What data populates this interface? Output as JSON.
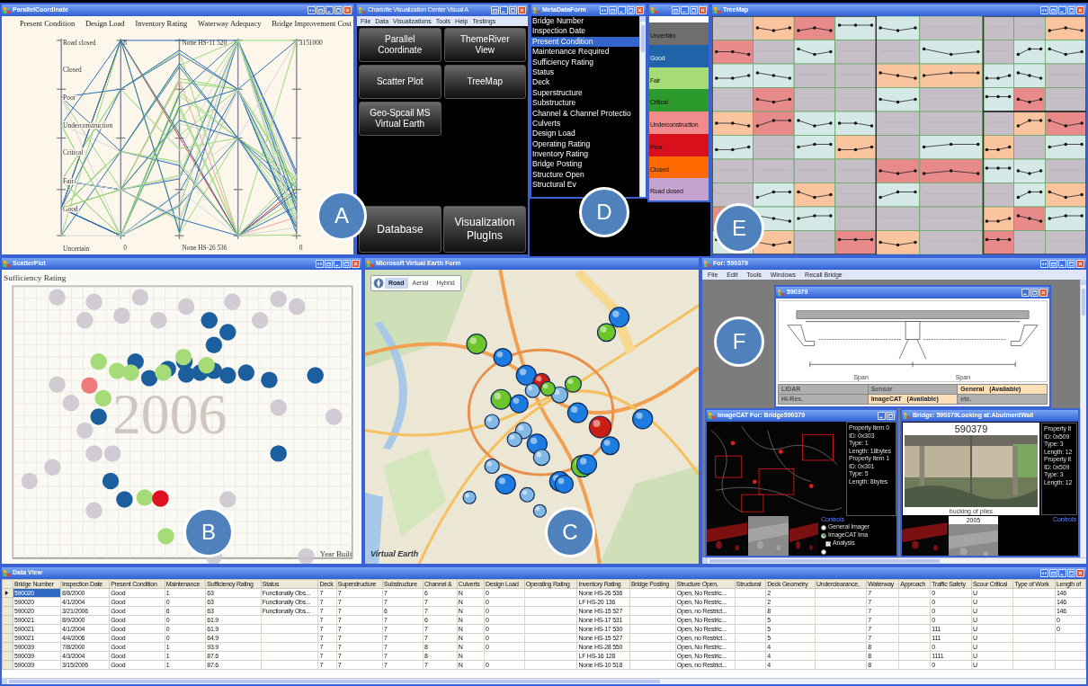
{
  "parallel_coordinate": {
    "title": "ParallelCoordinate",
    "axes": [
      {
        "title": "Present Condition"
      },
      {
        "title": "Design Load",
        "top_label": "8",
        "bottom_label": "0"
      },
      {
        "title": "Inventory Rating",
        "top_label": "None HS-11 520",
        "bottom_label": "None HS-26 536"
      },
      {
        "title": "Waterway Adequacy"
      },
      {
        "title": "Bridge Improvement Cost",
        "top_label": "3151000",
        "bottom_label": "0"
      }
    ],
    "category_labels": [
      "Road closed",
      "Closed",
      "Poor",
      "Underconstruction",
      "Critical",
      "Fair",
      "Good",
      "Uncertain"
    ]
  },
  "app": {
    "title": "Charlotte Visualization Center Visual A",
    "menu": [
      "File",
      "Data",
      "Visualizations",
      "Tools",
      "Help",
      "Testings"
    ],
    "buttons": [
      {
        "lines": [
          "Parallel",
          "Coordinate"
        ]
      },
      {
        "lines": [
          "ThemeRiver",
          "View"
        ]
      },
      {
        "lines": [
          "Scatter Plot"
        ]
      },
      {
        "lines": [
          "TreeMap"
        ]
      },
      {
        "lines": [
          "Geo-Spcail MS",
          "Virtual Earth"
        ]
      }
    ],
    "bottom_buttons": [
      {
        "lines": [
          "Database"
        ]
      },
      {
        "lines": [
          "Visualization",
          "PlugIns"
        ]
      }
    ]
  },
  "metadata_form": {
    "title": "MetaDataForm",
    "items": [
      {
        "label": "Bridge Number",
        "selected": false
      },
      {
        "label": "Inspection Date",
        "selected": false
      },
      {
        "label": "Present Condition",
        "selected": true
      },
      {
        "label": "Maintenance Required",
        "selected": false
      },
      {
        "label": "Sufficiency Rating",
        "selected": false
      },
      {
        "label": "Status",
        "selected": false
      },
      {
        "label": "Deck",
        "selected": false
      },
      {
        "label": "Superstructure",
        "selected": false
      },
      {
        "label": "Substructure",
        "selected": false
      },
      {
        "label": "Channel & Channel Protectio",
        "selected": false
      },
      {
        "label": "Culverts",
        "selected": false
      },
      {
        "label": "Design Load",
        "selected": false
      },
      {
        "label": "Operating Rating",
        "selected": false
      },
      {
        "label": "Inventory Rating",
        "selected": false
      },
      {
        "label": "Bridge Posting",
        "selected": false
      },
      {
        "label": "Structure Open",
        "selected": false
      },
      {
        "label": "Structural Ev",
        "selected": false
      }
    ]
  },
  "legend": {
    "items": [
      {
        "label": "Uncertain",
        "color": "#6e6e6e"
      },
      {
        "label": "Good",
        "color": "#1f64a8"
      },
      {
        "label": "Fair",
        "color": "#a6dc78"
      },
      {
        "label": "Critical",
        "color": "#2c9a2c"
      },
      {
        "label": "Underconstruction",
        "color": "#f28b8b"
      },
      {
        "label": "Poor",
        "color": "#d7101c"
      },
      {
        "label": "Closed",
        "color": "#ff6a00"
      },
      {
        "label": "Road closed",
        "color": "#c5a3d0"
      }
    ]
  },
  "treemap": {
    "title": "TreeMap"
  },
  "scatter_plot": {
    "title": "ScatterPlot",
    "y_label": "Sufficiency Rating",
    "x_label": "Year Built",
    "year": "2006"
  },
  "map": {
    "title": "Microsoft Virtual Earth Form",
    "view_tabs": [
      {
        "label": "Road",
        "selected": true
      },
      {
        "label": "Aerial",
        "selected": false
      },
      {
        "label": "Hybrid",
        "selected": false
      }
    ],
    "logo": "Virtual Earth"
  },
  "bridge_window": {
    "title": "For: 590379",
    "menu": [
      "File",
      "Edit",
      "Tools",
      "Windows",
      "Recall Bridge"
    ],
    "detail": {
      "title": "590379",
      "span_labels": [
        "Span",
        "Span"
      ],
      "sensor_rows": [
        [
          {
            "text": "LIDAR",
            "highlighted": false
          },
          {
            "text": "Sensor",
            "highlighted": false
          },
          {
            "text": "General   (Available)",
            "highlighted": true
          }
        ],
        [
          {
            "text": "Hi-Res.",
            "highlighted": false
          },
          {
            "text": "ImageCAT   (Available)",
            "highlighted": true
          },
          {
            "text": "etc.",
            "highlighted": false
          }
        ]
      ]
    },
    "imagecat": {
      "title": "ImageCAT For: Bridge590379",
      "properties": [
        "Property Item 0",
        "ID: 0x303",
        "Type: 1",
        "Length: 18bytes",
        "Property Item 1",
        "ID: 0x301",
        "Type: 5",
        "Length: 8bytes"
      ],
      "controls_title": "Controls",
      "controls": [
        {
          "kind": "radio",
          "label": "General Imager",
          "selected": false
        },
        {
          "kind": "radio",
          "label": "ImageCAT Ima",
          "selected": true
        },
        {
          "kind": "checkbox",
          "label": "Analysis",
          "checked": true
        },
        {
          "kind": "radio",
          "selected": false
        }
      ]
    },
    "photo_view": {
      "title": "Bridge: 590379Looking at:AbutmentWall",
      "heading": "590379",
      "caption": "bucking of piles",
      "properties": [
        "Property It",
        "ID: 0x509",
        "Type: 3",
        "Length: 12",
        "Property It",
        "ID: 0x509",
        "Type: 3",
        "Length: 12"
      ],
      "thumbnail_label": "2005",
      "controls_title": "Controls"
    }
  },
  "data_view": {
    "title": "Data View",
    "columns": [
      "Bridge Number",
      "Inspection Date",
      "Present Condition",
      "Maintenance",
      "Sufficiency Rating",
      "Status",
      "Deck",
      "Superstructure",
      "Substructure",
      "Channel &",
      "Culverts",
      "Design Load",
      "Operating Rating",
      "Inventory Rating",
      "Bridge Posting",
      "Structure Open,",
      "Structural",
      "Deck Geometry",
      "Underclearance,",
      "Waterway",
      "Approach",
      "Traffic Safety",
      "Scour Critical",
      "Type of Work",
      "Length of"
    ],
    "rows": [
      {
        "selected": true,
        "cells": [
          "590020",
          "8/8/2000",
          "Good",
          "1",
          "63",
          "Functionally Obs...",
          "7",
          "7",
          "7",
          "6",
          "N",
          "0",
          null,
          "None HS-26 536",
          null,
          "Open, No Restric...",
          null,
          "2",
          null,
          "7",
          null,
          "0",
          "U",
          null,
          "146"
        ]
      },
      {
        "selected": false,
        "cells": [
          "590020",
          "4/1/2004",
          "Good",
          "0",
          "63",
          "Functionally Obs...",
          "7",
          "7",
          "7",
          "7",
          "N",
          "0",
          null,
          "LF HS-20 136",
          null,
          "Open, No Restric...",
          null,
          "2",
          null,
          "7",
          null,
          "0",
          "U",
          null,
          "146"
        ]
      },
      {
        "selected": false,
        "cells": [
          "590020",
          "3/21/2006",
          "Good",
          "6",
          "63",
          "Functionally Obs...",
          "7",
          "7",
          "6",
          "7",
          "N",
          "0",
          null,
          "None HS-15 527",
          null,
          "Open, no Restrict...",
          null,
          "8",
          null,
          "7",
          null,
          "0",
          "U",
          null,
          "146"
        ]
      },
      {
        "selected": false,
        "cells": [
          "590021",
          "8/9/2000",
          "Good",
          "0",
          "61.9",
          null,
          "7",
          "7",
          "7",
          "6",
          "N",
          "0",
          null,
          "None HS-17 531",
          null,
          "Open, No Restric...",
          null,
          "5",
          null,
          "7",
          null,
          "0",
          "U",
          null,
          "0"
        ]
      },
      {
        "selected": false,
        "cells": [
          "590021",
          "4/1/2004",
          "Good",
          "0",
          "61.9",
          null,
          "7",
          "7",
          "7",
          "7",
          "N",
          "0",
          null,
          "None HS-17 530",
          null,
          "Open, No Restric...",
          null,
          "5",
          null,
          "7",
          null,
          "111",
          "U",
          null,
          "0"
        ]
      },
      {
        "selected": false,
        "cells": [
          "590021",
          "4/4/2006",
          "Good",
          "0",
          "64.9",
          null,
          "7",
          "7",
          "7",
          "7",
          "N",
          "0",
          null,
          "None HS-15 527",
          null,
          "Open, no Restrict...",
          null,
          "5",
          null,
          "7",
          null,
          "111",
          "U",
          null,
          null
        ]
      },
      {
        "selected": false,
        "cells": [
          "590039",
          "7/8/2000",
          "Good",
          "1",
          "93.9",
          null,
          "7",
          "7",
          "7",
          "8",
          "N",
          "0",
          null,
          "None HS-28 550",
          null,
          "Open, No Restric...",
          null,
          "4",
          null,
          "8",
          null,
          "0",
          "U",
          null,
          null
        ]
      },
      {
        "selected": false,
        "cells": [
          "590039",
          "4/3/2004",
          "Good",
          "1",
          "87.6",
          null,
          "7",
          "7",
          "7",
          "8",
          "N",
          null,
          null,
          "LF HS-16 128",
          null,
          "Open, No Restric...",
          null,
          "4",
          null,
          "8",
          null,
          "1111",
          "U",
          null,
          null
        ]
      },
      {
        "selected": false,
        "cells": [
          "590039",
          "3/15/2006",
          "Good",
          "1",
          "87.6",
          null,
          "7",
          "7",
          "7",
          "7",
          "N",
          "0",
          null,
          "None HS-10 518",
          null,
          "Open, no Restrict...",
          null,
          "4",
          null,
          "8",
          null,
          "0",
          "U",
          null,
          null
        ]
      }
    ]
  },
  "callouts": [
    "A",
    "B",
    "C",
    "D",
    "E",
    "F"
  ]
}
